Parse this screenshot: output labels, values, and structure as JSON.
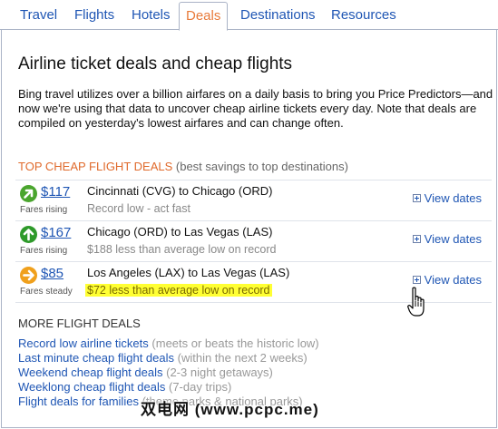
{
  "tabs": [
    {
      "label": "Travel"
    },
    {
      "label": "Flights"
    },
    {
      "label": "Hotels"
    },
    {
      "label": "Deals",
      "active": true
    },
    {
      "label": "Destinations"
    },
    {
      "label": "Resources"
    }
  ],
  "page_title": "Airline ticket deals and cheap flights",
  "intro": "Bing travel utilizes over a billion airfares on a daily basis to bring you Price Predictors—and now we're using that data to uncover cheap airline tickets every day. Note that deals are compiled on yesterday's lowest airfares and can change often.",
  "top_deals": {
    "title": "TOP CHEAP FLIGHT DEALS",
    "subtitle": "(best savings to top destinations)",
    "items": [
      {
        "price": "$117",
        "trend": "Fares rising",
        "route": "Cincinnati (CVG) to Chicago (ORD)",
        "note": "Record low - act fast",
        "link": "View dates",
        "arrow_color": "#4aa52e",
        "arrow_icon": "arrow-up-right"
      },
      {
        "price": "$167",
        "trend": "Fares rising",
        "route": "Chicago (ORD) to Las Vegas (LAS)",
        "note": "$188 less than average low on record",
        "link": "View dates",
        "arrow_color": "#2e9a2a",
        "arrow_icon": "arrow-up"
      },
      {
        "price": "$85",
        "trend": "Fares steady",
        "route": "Los Angeles (LAX) to Las Vegas (LAS)",
        "note": "$72 less than average low on record",
        "link": "View dates",
        "arrow_color": "#f0a01c",
        "arrow_icon": "arrow-right",
        "highlight": true
      }
    ]
  },
  "more_deals": {
    "title": "MORE FLIGHT DEALS",
    "items": [
      {
        "link": "Record low airline tickets",
        "desc": "(meets or beats the historic low)"
      },
      {
        "link": "Last minute cheap flight deals",
        "desc": "(within the next 2 weeks)"
      },
      {
        "link": "Weekend cheap flight deals",
        "desc": "(2-3 night getaways)"
      },
      {
        "link": "Weeklong cheap flight deals",
        "desc": "(7-day trips)"
      },
      {
        "link": "Flight deals for families",
        "desc": "(theme parks & national parks)"
      }
    ]
  },
  "watermark": "双电网 (www.pcpc.me)",
  "colors": {
    "link": "#1f56b4",
    "accent": "#e06a2c",
    "highlight": "#ffff33"
  }
}
